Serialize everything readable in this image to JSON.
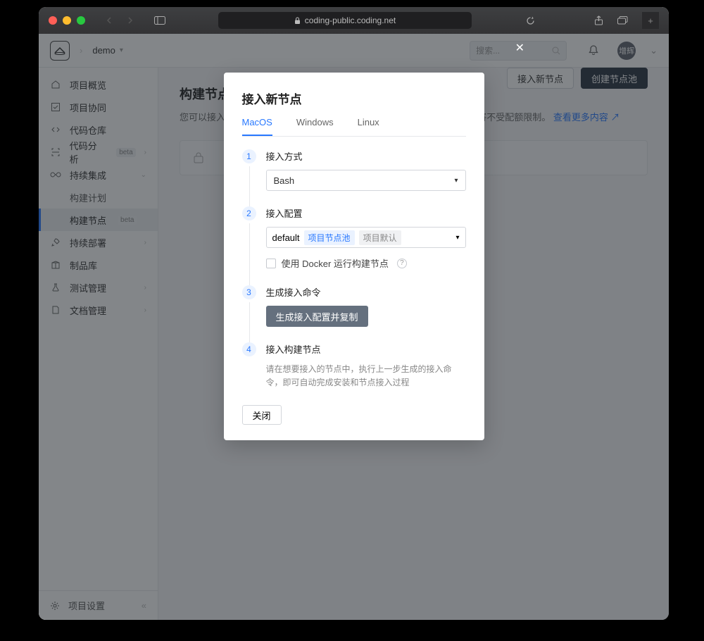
{
  "browser": {
    "url_host": "coding-public.coding.net"
  },
  "header": {
    "crumb": "demo",
    "search_placeholder": "搜索...",
    "user_short": "增辉"
  },
  "sidebar": {
    "items": [
      {
        "label": "项目概览"
      },
      {
        "label": "项目协同"
      },
      {
        "label": "代码仓库"
      },
      {
        "label": "代码分析",
        "beta": "beta"
      },
      {
        "label": "持续集成"
      },
      {
        "label": "构建计划",
        "sub": true
      },
      {
        "label": "构建节点",
        "sub": true,
        "beta": "beta",
        "active": true
      },
      {
        "label": "持续部署"
      },
      {
        "label": "制品库"
      },
      {
        "label": "测试管理"
      },
      {
        "label": "文档管理"
      }
    ],
    "footer": "项目设置"
  },
  "main": {
    "title": "构建节点",
    "desc_prefix": "您可以接入",
    "desc_suffix": "和构建次数将不受配额限制。",
    "desc_link": "查看更多内容",
    "btn_connect": "接入新节点",
    "btn_create": "创建节点池"
  },
  "modal": {
    "title": "接入新节点",
    "tabs": [
      "MacOS",
      "Windows",
      "Linux"
    ],
    "active_tab": 0,
    "step1": {
      "label": "接入方式",
      "value": "Bash"
    },
    "step2": {
      "label": "接入配置",
      "value": "default",
      "chip1": "项目节点池",
      "chip2": "项目默认",
      "checkbox_label": "使用 Docker 运行构建节点"
    },
    "step3": {
      "label": "生成接入命令",
      "button": "生成接入配置并复制"
    },
    "step4": {
      "label": "接入构建节点",
      "help": "请在想要接入的节点中，执行上一步生成的接入命令，即可自动完成安装和节点接入过程"
    },
    "close_label": "关闭"
  }
}
